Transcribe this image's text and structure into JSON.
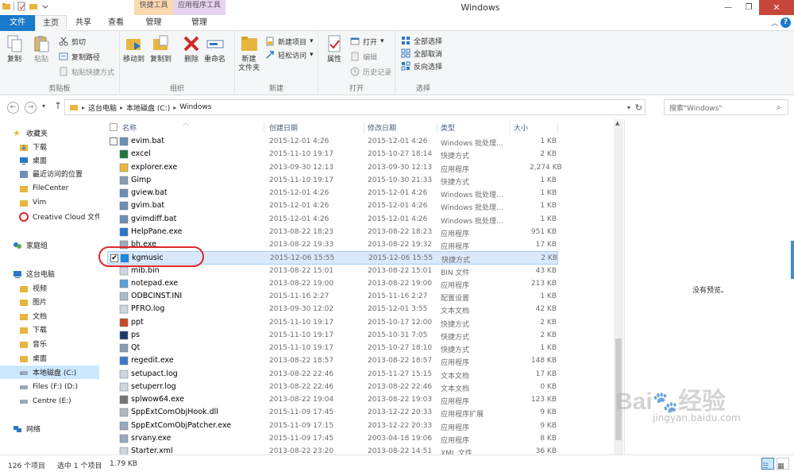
{
  "window": {
    "title": "Windows"
  },
  "context_tabs": [
    "快捷工具",
    "应用程序工具"
  ],
  "tabs": [
    "文件",
    "主页",
    "共享",
    "查看",
    "管理"
  ],
  "ribbon": {
    "clipboard": {
      "copy": "复制",
      "paste": "粘贴",
      "cut": "剪切",
      "copy_path": "复制路径",
      "paste_shortcut": "粘贴快捷方式",
      "label": "剪贴板"
    },
    "organize": {
      "move_to": "移动到",
      "copy_to": "复制到",
      "delete": "删除",
      "rename": "重命名",
      "label": "组织"
    },
    "new": {
      "new_folder_1": "新建",
      "new_folder_2": "文件夹",
      "new_item": "新建项目",
      "easy_access": "轻松访问",
      "label": "新建"
    },
    "open": {
      "properties": "属性",
      "open": "打开",
      "edit": "编辑",
      "history": "历史记录",
      "label": "打开"
    },
    "select": {
      "select_all": "全部选择",
      "select_none": "全部取消",
      "invert": "反向选择",
      "label": "选择"
    }
  },
  "address": {
    "crumbs": [
      "这台电脑",
      "本地磁盘 (C:)",
      "Windows"
    ],
    "search_placeholder": "搜索\"Windows\""
  },
  "nav": {
    "favorites": "收藏夹",
    "fav_items": [
      "下载",
      "桌面",
      "最近访问的位置",
      "FileCenter",
      "Vim",
      "Creative Cloud 文件"
    ],
    "homegroup": "家庭组",
    "this_pc": "这台电脑",
    "pc_items": [
      "视频",
      "图片",
      "文档",
      "下载",
      "音乐",
      "桌面",
      "本地磁盘 (C:)",
      "Files (F:) (D:)",
      "Centre (E:)"
    ],
    "network": "网络"
  },
  "columns": {
    "name": "名称",
    "created": "创建日期",
    "modified": "修改日期",
    "type": "类型",
    "size": "大小"
  },
  "files": [
    {
      "name": "evim.bat",
      "created": "2015-12-01 4:26",
      "modified": "2015-12-01 4:26",
      "type": "Windows 批处理...",
      "size": "1 KB",
      "icon": "batch-icon"
    },
    {
      "name": "excel",
      "created": "2015-11-10 19:17",
      "modified": "2015-10-27 18:14",
      "type": "快捷方式",
      "size": "2 KB",
      "icon": "excel-shortcut-icon"
    },
    {
      "name": "explorer.exe",
      "created": "2013-09-30 12:13",
      "modified": "2013-09-30 12:13",
      "type": "应用程序",
      "size": "2,274 KB",
      "icon": "explorer-icon"
    },
    {
      "name": "Gimp",
      "created": "2015-11-10 19:17",
      "modified": "2015-10-30 21:33",
      "type": "快捷方式",
      "size": "1 KB",
      "icon": "shortcut-icon"
    },
    {
      "name": "gview.bat",
      "created": "2015-12-01 4:26",
      "modified": "2015-12-01 4:26",
      "type": "Windows 批处理...",
      "size": "1 KB",
      "icon": "batch-icon"
    },
    {
      "name": "gvim.bat",
      "created": "2015-12-01 4:26",
      "modified": "2015-12-01 4:26",
      "type": "Windows 批处理...",
      "size": "1 KB",
      "icon": "batch-icon"
    },
    {
      "name": "gvimdiff.bat",
      "created": "2015-12-01 4:26",
      "modified": "2015-12-01 4:26",
      "type": "Windows 批处理...",
      "size": "1 KB",
      "icon": "batch-icon"
    },
    {
      "name": "HelpPane.exe",
      "created": "2013-08-22 18:23",
      "modified": "2013-08-22 18:23",
      "type": "应用程序",
      "size": "951 KB",
      "icon": "help-icon"
    },
    {
      "name": "bh.exe",
      "created": "2013-08-22 19:33",
      "modified": "2013-08-22 19:32",
      "type": "应用程序",
      "size": "17 KB",
      "icon": "app-icon"
    },
    {
      "name": "kgmusic",
      "created": "2015-12-06 15:55",
      "modified": "2015-12-06 15:55",
      "type": "快捷方式",
      "size": "2 KB",
      "icon": "kgmusic-icon",
      "selected": true
    },
    {
      "name": "mib.bin",
      "created": "2013-08-22 15:01",
      "modified": "2013-08-22 15:01",
      "type": "BIN 文件",
      "size": "43 KB",
      "icon": "file-icon"
    },
    {
      "name": "notepad.exe",
      "created": "2013-08-22 19:00",
      "modified": "2013-08-22 19:00",
      "type": "应用程序",
      "size": "213 KB",
      "icon": "notepad-icon"
    },
    {
      "name": "ODBCINST.INI",
      "created": "2015-11-16 2:27",
      "modified": "2015-11-16 2:27",
      "type": "配置设置",
      "size": "1 KB",
      "icon": "ini-icon"
    },
    {
      "name": "PFRO.log",
      "created": "2013-09-30 12:02",
      "modified": "2015-12-01 3:55",
      "type": "文本文档",
      "size": "42 KB",
      "icon": "text-icon"
    },
    {
      "name": "ppt",
      "created": "2015-11-10 19:17",
      "modified": "2015-10-17 12:00",
      "type": "快捷方式",
      "size": "2 KB",
      "icon": "ppt-shortcut-icon"
    },
    {
      "name": "ps",
      "created": "2015-11-10 19:17",
      "modified": "2015-10-31 7:05",
      "type": "快捷方式",
      "size": "2 KB",
      "icon": "ps-shortcut-icon"
    },
    {
      "name": "Qt",
      "created": "2015-11-10 19:17",
      "modified": "2015-10-27 18:10",
      "type": "快捷方式",
      "size": "1 KB",
      "icon": "shortcut-icon"
    },
    {
      "name": "regedit.exe",
      "created": "2013-08-22 18:57",
      "modified": "2013-08-22 18:57",
      "type": "应用程序",
      "size": "148 KB",
      "icon": "regedit-icon"
    },
    {
      "name": "setupact.log",
      "created": "2013-08-22 22:46",
      "modified": "2015-11-27 15:15",
      "type": "文本文档",
      "size": "17 KB",
      "icon": "text-icon"
    },
    {
      "name": "setuperr.log",
      "created": "2013-08-22 22:46",
      "modified": "2013-08-22 22:46",
      "type": "文本文档",
      "size": "0 KB",
      "icon": "text-icon"
    },
    {
      "name": "splwow64.exe",
      "created": "2013-08-22 19:04",
      "modified": "2013-08-22 19:03",
      "type": "应用程序",
      "size": "123 KB",
      "icon": "printer-icon"
    },
    {
      "name": "SppExtComObjHook.dll",
      "created": "2015-11-09 17:45",
      "modified": "2013-12-22 20:33",
      "type": "应用程序扩展",
      "size": "9 KB",
      "icon": "dll-icon"
    },
    {
      "name": "SppExtComObjPatcher.exe",
      "created": "2015-11-09 17:15",
      "modified": "2013-12-22 20:33",
      "type": "应用程序",
      "size": "9 KB",
      "icon": "app-icon"
    },
    {
      "name": "srvany.exe",
      "created": "2015-11-09 17:45",
      "modified": "2003-04-18 19:06",
      "type": "应用程序",
      "size": "8 KB",
      "icon": "app-icon"
    },
    {
      "name": "Starter.xml",
      "created": "2013-08-22 23:20",
      "modified": "2013-08-22 14:51",
      "type": "XML 文件",
      "size": "36 KB",
      "icon": "xml-icon"
    }
  ],
  "preview": {
    "message": "没有预览。"
  },
  "watermark": {
    "text": "Bai",
    "text2": "经验",
    "sub": "jingyan.baidu.com"
  },
  "status": {
    "count": "126 个项目",
    "selected": "选中 1 个项目",
    "size": "1.79 KB"
  },
  "colors": {
    "file_tab": "#1979ca",
    "selection": "#d9e8fb",
    "annotation": "#e0262e"
  }
}
